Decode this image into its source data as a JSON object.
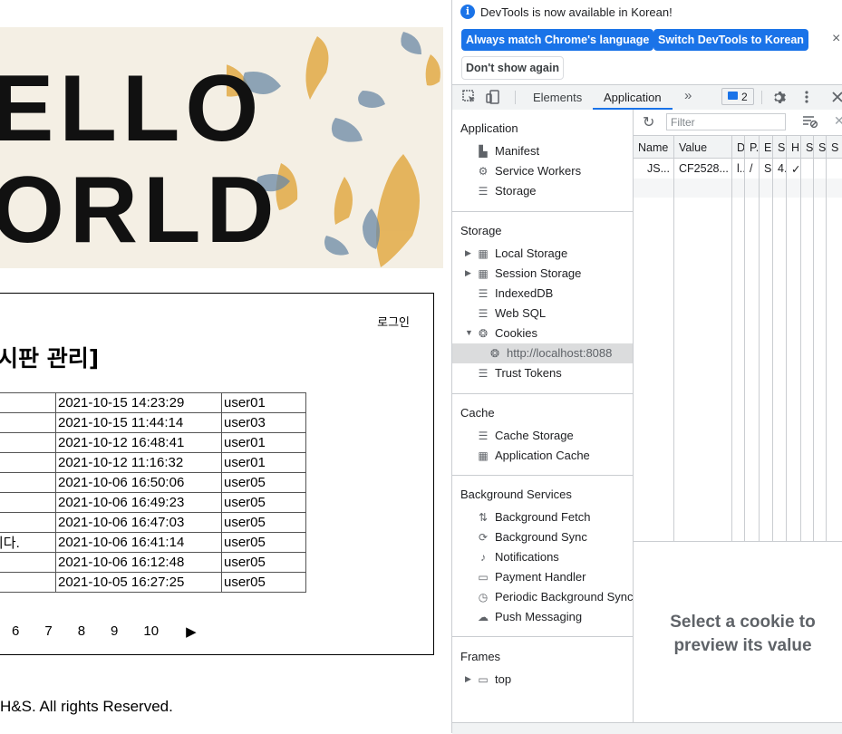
{
  "page": {
    "banner": {
      "line1": "ELLO",
      "line2": "ORLD"
    },
    "login_label": "로그인",
    "board_title": "시판 관리]",
    "posts": [
      {
        "title": "",
        "date": "2021-10-15 14:23:29",
        "user": "user01"
      },
      {
        "title": "",
        "date": "2021-10-15 11:44:14",
        "user": "user03"
      },
      {
        "title": "",
        "date": "2021-10-12 16:48:41",
        "user": "user01"
      },
      {
        "title": "",
        "date": "2021-10-12 11:16:32",
        "user": "user01"
      },
      {
        "title": "",
        "date": "2021-10-06 16:50:06",
        "user": "user05"
      },
      {
        "title": "",
        "date": "2021-10-06 16:49:23",
        "user": "user05"
      },
      {
        "title": "",
        "date": "2021-10-06 16:47:03",
        "user": "user05"
      },
      {
        "title": "니다.",
        "date": "2021-10-06 16:41:14",
        "user": "user05"
      },
      {
        "title": "",
        "date": "2021-10-06 16:12:48",
        "user": "user05"
      },
      {
        "title": "",
        "date": "2021-10-05 16:27:25",
        "user": "user05"
      }
    ],
    "pager": [
      "6",
      "7",
      "8",
      "9",
      "10"
    ],
    "pager_next": "▶",
    "copyright": "H&S. All rights Reserved."
  },
  "devtools": {
    "infobar": {
      "message": "DevTools is now available in Korean!",
      "btn_match": "Always match Chrome's language",
      "btn_switch": "Switch DevTools to Korean",
      "btn_dismiss": "Don't show again",
      "close": "×"
    },
    "tabs": {
      "elements": "Elements",
      "application": "Application",
      "more": "»",
      "issues_count": "2"
    },
    "sidebar": {
      "application": {
        "title": "Application",
        "items": [
          {
            "label": "Manifest",
            "icon": "file-icon"
          },
          {
            "label": "Service Workers",
            "icon": "gear-icon"
          },
          {
            "label": "Storage",
            "icon": "database-icon"
          }
        ]
      },
      "storage": {
        "title": "Storage",
        "items": [
          {
            "label": "Local Storage",
            "icon": "grid-icon"
          },
          {
            "label": "Session Storage",
            "icon": "grid-icon"
          },
          {
            "label": "IndexedDB",
            "icon": "database-icon"
          },
          {
            "label": "Web SQL",
            "icon": "database-icon"
          },
          {
            "label": "Cookies",
            "icon": "cookie-icon"
          },
          {
            "label": "http://localhost:8088",
            "icon": "cookie-icon"
          },
          {
            "label": "Trust Tokens",
            "icon": "database-icon"
          }
        ]
      },
      "cache": {
        "title": "Cache",
        "items": [
          {
            "label": "Cache Storage",
            "icon": "database-icon"
          },
          {
            "label": "Application Cache",
            "icon": "grid-icon"
          }
        ]
      },
      "background": {
        "title": "Background Services",
        "items": [
          {
            "label": "Background Fetch",
            "icon": "updown-arrows-icon"
          },
          {
            "label": "Background Sync",
            "icon": "sync-icon"
          },
          {
            "label": "Notifications",
            "icon": "bell-icon"
          },
          {
            "label": "Payment Handler",
            "icon": "card-icon"
          },
          {
            "label": "Periodic Background Sync",
            "icon": "clock-icon"
          },
          {
            "label": "Push Messaging",
            "icon": "cloud-icon"
          }
        ]
      },
      "frames": {
        "title": "Frames",
        "items": [
          {
            "label": "top",
            "icon": "frame-icon"
          }
        ]
      }
    },
    "cookies": {
      "filter_placeholder": "Filter",
      "columns": [
        "Name",
        "Value",
        "D",
        "P.",
        "E.",
        "S.",
        "H",
        "S.",
        "S.",
        "S"
      ],
      "row": [
        "JS...",
        "CF2528...",
        "l..",
        "/",
        "S.",
        "4.",
        "✓",
        "",
        "",
        ""
      ],
      "preview_text": "Select a cookie to preview its value"
    }
  }
}
